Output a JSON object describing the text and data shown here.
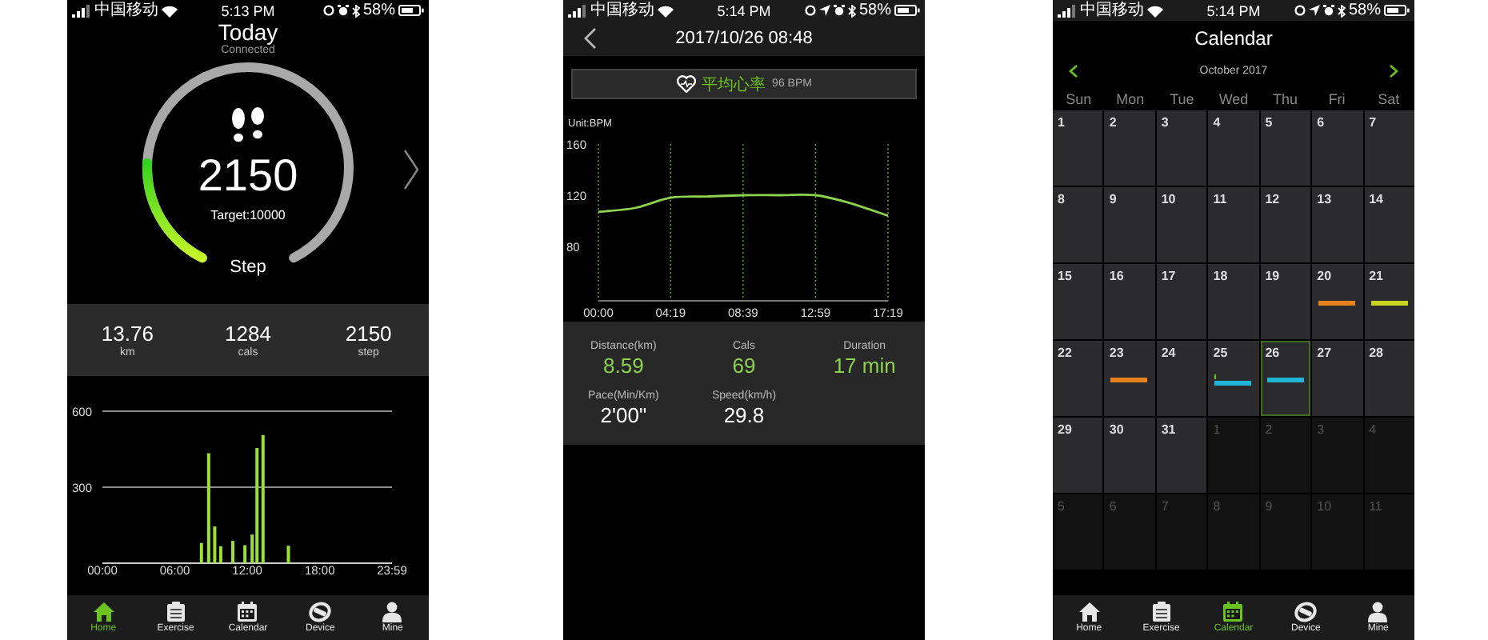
{
  "today": {
    "status_bar": {
      "carrier": "中国移动",
      "time": "5:13 PM",
      "battery": "58%",
      "location": false
    },
    "title": "Today",
    "subtitle": "Connected",
    "ring": {
      "value": "2150",
      "target": "Target:10000",
      "label": "Step"
    },
    "stats": [
      {
        "value": "13.76",
        "unit": "km"
      },
      {
        "value": "1284",
        "unit": "cals"
      },
      {
        "value": "2150",
        "unit": "step"
      }
    ],
    "chart_data": {
      "type": "bar",
      "x": [
        8.2,
        8.8,
        9.3,
        9.8,
        10.8,
        11.8,
        12.4,
        12.8,
        13.3,
        15.4
      ],
      "series": [
        {
          "color": "#9be03a",
          "values": [
            80,
            434,
            145,
            67,
            88,
            71,
            113,
            455,
            506,
            69
          ]
        }
      ],
      "xlim": [
        0,
        23.98
      ],
      "ylim": [
        0,
        600
      ],
      "grid": true,
      "xticks": [
        {
          "value": 0,
          "label": "00:00"
        },
        {
          "value": 6,
          "label": "06:00"
        },
        {
          "value": 12,
          "label": "12:00"
        },
        {
          "value": 18,
          "label": "18:00"
        },
        {
          "value": 23.98,
          "label": "23:59"
        }
      ],
      "yticks": [
        300,
        600
      ]
    },
    "tab_bar": [
      {
        "label": "Home",
        "kind": "home",
        "selected": true
      },
      {
        "label": "Exercise",
        "kind": "exercise",
        "selected": false
      },
      {
        "label": "Calendar",
        "kind": "calendar",
        "selected": false
      },
      {
        "label": "Device",
        "kind": "device",
        "selected": false
      },
      {
        "label": "Mine",
        "kind": "mine",
        "selected": false
      }
    ]
  },
  "detail": {
    "status_bar": {
      "carrier": "中国移动",
      "time": "5:14 PM",
      "battery": "58%",
      "location": true
    },
    "title": "2017/10/26 08:48",
    "heart_rate": {
      "label": "平均心率",
      "value": "96 BPM"
    },
    "chart_data": {
      "type": "line",
      "ylabel": "Unit:BPM",
      "x": [
        0,
        130,
        259,
        389,
        519,
        649,
        779,
        900,
        1039
      ],
      "series": [
        {
          "color": "#8ed14f",
          "values": [
            107,
            110,
            118,
            119,
            120,
            120,
            120,
            114,
            104
          ]
        }
      ],
      "xlim": [
        0,
        1039
      ],
      "ylim": [
        37.5,
        160
      ],
      "grid": true,
      "xticks": [
        {
          "value": 0,
          "label": "00:00"
        },
        {
          "value": 259,
          "label": "04:19"
        },
        {
          "value": 519,
          "label": "08:39"
        },
        {
          "value": 779,
          "label": "12:59"
        },
        {
          "value": 1039,
          "label": "17:19"
        }
      ],
      "yticks": [
        80,
        120,
        160
      ]
    },
    "stats": [
      {
        "label": "Distance(km)",
        "value": "8.59",
        "color": "#8ed14f"
      },
      {
        "label": "Cals",
        "value": "69",
        "color": "#8ed14f"
      },
      {
        "label": "Duration",
        "value": "17 min",
        "color": "#8ed14f"
      },
      {
        "label": "Pace(Min/Km)",
        "value": "2'00\"",
        "color": "#ffffff"
      },
      {
        "label": "Speed(km/h)",
        "value": "29.8",
        "color": "#ffffff"
      }
    ]
  },
  "calendar": {
    "status_bar": {
      "carrier": "中国移动",
      "time": "5:14 PM",
      "battery": "58%",
      "location": true
    },
    "title": "Calendar",
    "month": "October 2017",
    "weekdays": [
      "Sun",
      "Mon",
      "Tue",
      "Wed",
      "Thu",
      "Fri",
      "Sat"
    ],
    "days": [
      {
        "day": "1",
        "in_month": true,
        "selected": false,
        "marked": false
      },
      {
        "day": "2",
        "in_month": true,
        "selected": false,
        "marked": false
      },
      {
        "day": "3",
        "in_month": true,
        "selected": false,
        "marked": false
      },
      {
        "day": "4",
        "in_month": true,
        "selected": false,
        "marked": false
      },
      {
        "day": "5",
        "in_month": true,
        "selected": false,
        "marked": false
      },
      {
        "day": "6",
        "in_month": true,
        "selected": false,
        "marked": false
      },
      {
        "day": "7",
        "in_month": true,
        "selected": false,
        "marked": false
      },
      {
        "day": "8",
        "in_month": true,
        "selected": false,
        "marked": false
      },
      {
        "day": "9",
        "in_month": true,
        "selected": false,
        "marked": false
      },
      {
        "day": "10",
        "in_month": true,
        "selected": false,
        "marked": false
      },
      {
        "day": "11",
        "in_month": true,
        "selected": false,
        "marked": false
      },
      {
        "day": "12",
        "in_month": true,
        "selected": false,
        "marked": false
      },
      {
        "day": "13",
        "in_month": true,
        "selected": false,
        "marked": false
      },
      {
        "day": "14",
        "in_month": true,
        "selected": false,
        "marked": false
      },
      {
        "day": "15",
        "in_month": true,
        "selected": false,
        "marked": false
      },
      {
        "day": "16",
        "in_month": true,
        "selected": false,
        "marked": false
      },
      {
        "day": "17",
        "in_month": true,
        "selected": false,
        "marked": false
      },
      {
        "day": "18",
        "in_month": true,
        "selected": false,
        "marked": false
      },
      {
        "day": "19",
        "in_month": true,
        "selected": false,
        "marked": false
      },
      {
        "day": "20",
        "in_month": true,
        "selected": false,
        "marked": false,
        "events": [
          {
            "color": "#e8821e"
          }
        ]
      },
      {
        "day": "21",
        "in_month": true,
        "selected": false,
        "marked": false,
        "events": [
          {
            "color": "#c8d41e"
          }
        ]
      },
      {
        "day": "22",
        "in_month": true,
        "selected": false,
        "marked": false
      },
      {
        "day": "23",
        "in_month": true,
        "selected": false,
        "marked": false,
        "events": [
          {
            "color": "#e8821e"
          }
        ]
      },
      {
        "day": "24",
        "in_month": true,
        "selected": false,
        "marked": false
      },
      {
        "day": "25",
        "in_month": true,
        "selected": false,
        "marked": true,
        "events": [
          {
            "color": "#1fb5d6"
          }
        ]
      },
      {
        "day": "26",
        "in_month": true,
        "selected": true,
        "marked": false,
        "events": [
          {
            "color": "#1fb5d6"
          }
        ]
      },
      {
        "day": "27",
        "in_month": true,
        "selected": false,
        "marked": false
      },
      {
        "day": "28",
        "in_month": true,
        "selected": false,
        "marked": false
      },
      {
        "day": "29",
        "in_month": true,
        "selected": false,
        "marked": false
      },
      {
        "day": "30",
        "in_month": true,
        "selected": false,
        "marked": false
      },
      {
        "day": "31",
        "in_month": true,
        "selected": false,
        "marked": false
      },
      {
        "day": "1",
        "in_month": false,
        "selected": false,
        "marked": false
      },
      {
        "day": "2",
        "in_month": false,
        "selected": false,
        "marked": false
      },
      {
        "day": "3",
        "in_month": false,
        "selected": false,
        "marked": false
      },
      {
        "day": "4",
        "in_month": false,
        "selected": false,
        "marked": false
      },
      {
        "day": "5",
        "in_month": false,
        "selected": false,
        "marked": false
      },
      {
        "day": "6",
        "in_month": false,
        "selected": false,
        "marked": false
      },
      {
        "day": "7",
        "in_month": false,
        "selected": false,
        "marked": false
      },
      {
        "day": "8",
        "in_month": false,
        "selected": false,
        "marked": false
      },
      {
        "day": "9",
        "in_month": false,
        "selected": false,
        "marked": false
      },
      {
        "day": "10",
        "in_month": false,
        "selected": false,
        "marked": false
      },
      {
        "day": "11",
        "in_month": false,
        "selected": false,
        "marked": false
      }
    ],
    "tab_bar": [
      {
        "label": "Home",
        "kind": "home",
        "selected": false
      },
      {
        "label": "Exercise",
        "kind": "exercise",
        "selected": false
      },
      {
        "label": "Calendar",
        "kind": "calendar",
        "selected": true
      },
      {
        "label": "Device",
        "kind": "device",
        "selected": false
      },
      {
        "label": "Mine",
        "kind": "mine",
        "selected": false
      }
    ]
  }
}
